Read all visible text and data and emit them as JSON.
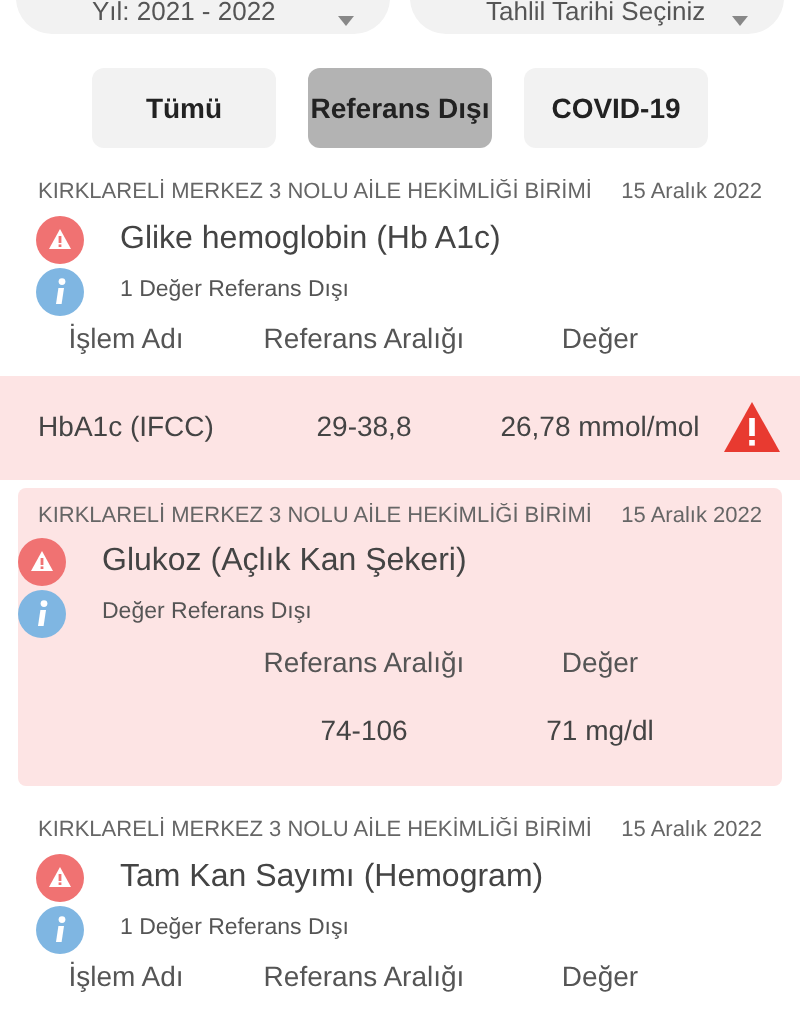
{
  "filters": [
    {
      "value": "Yıl: 2021 - 2022"
    },
    {
      "value": "Tahlil Tarihi Seçiniz"
    }
  ],
  "tabs": [
    {
      "label": "Tümü",
      "selected": false
    },
    {
      "label": "Referans Dışı",
      "selected": true
    },
    {
      "label": "COVID-19",
      "selected": false
    }
  ],
  "results": [
    {
      "institution": "KIRKLARELİ MERKEZ 3 NOLU AİLE HEKİMLİĞİ BİRİMİ",
      "date": "15 Aralık 2022",
      "title": "Glike hemoglobin (Hb A1c)",
      "summary": "1 Değer Referans Dışı",
      "highlighted": false,
      "columns": {
        "name": "İşlem Adı",
        "range": "Referans Aralığı",
        "value": "Değer"
      },
      "rows": [
        {
          "name": "HbA1c (IFCC)",
          "range": "29-38,8",
          "value": "26,78 mmol/mol",
          "flagged": true
        }
      ]
    },
    {
      "institution": "KIRKLARELİ MERKEZ 3 NOLU AİLE HEKİMLİĞİ BİRİMİ",
      "date": "15 Aralık 2022",
      "title": "Glukoz (Açlık Kan Şekeri)",
      "summary": "Değer Referans Dışı",
      "highlighted": true,
      "columns": {
        "range": "Referans Aralığı",
        "value": "Değer"
      },
      "rows": [
        {
          "range": "74-106",
          "value": "71 mg/dl",
          "flagged": false
        }
      ]
    },
    {
      "institution": "KIRKLARELİ MERKEZ 3 NOLU AİLE HEKİMLİĞİ BİRİMİ",
      "date": "15 Aralık 2022",
      "title": "Tam Kan Sayımı (Hemogram)",
      "summary": "1 Değer Referans Dışı",
      "highlighted": false,
      "columns": {
        "name": "İşlem Adı",
        "range": "Referans Aralığı",
        "value": "Değer"
      }
    }
  ]
}
